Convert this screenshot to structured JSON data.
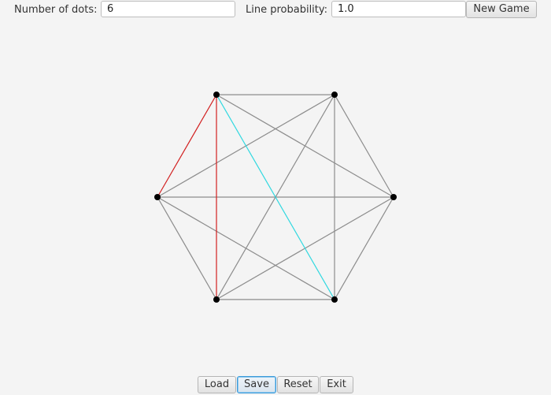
{
  "toolbar": {
    "dots_label": "Number of dots:",
    "dots_value": "6",
    "prob_label": "Line probability:",
    "prob_value": "1.0",
    "new_game_label": "New Game"
  },
  "board": {
    "colors": {
      "line": "#8c8c8c",
      "player1": "#d22020",
      "player2": "#30d8e0",
      "dot": "#000000"
    },
    "dot_count": 6,
    "colored_edges": [
      {
        "from": 1,
        "to": 4,
        "color": "player2"
      },
      {
        "from": 2,
        "to": 4,
        "color": "player1"
      },
      {
        "from": 3,
        "to": 4,
        "color": "player1"
      }
    ]
  },
  "bottom": {
    "load_label": "Load",
    "save_label": "Save",
    "reset_label": "Reset",
    "exit_label": "Exit"
  }
}
